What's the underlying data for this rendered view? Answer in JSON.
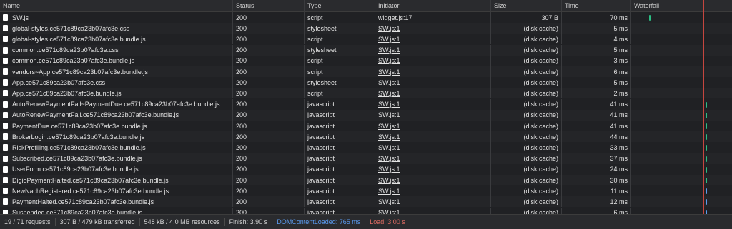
{
  "columns": {
    "name": "Name",
    "status": "Status",
    "type": "Type",
    "initiator": "Initiator",
    "size": "Size",
    "time": "Time",
    "waterfall": "Waterfall"
  },
  "rows": [
    {
      "name": "SW.js",
      "status": "200",
      "type": "script",
      "initiator": "widget.js:17",
      "size": "307 B",
      "time": "70 ms",
      "wf_pos": 0.18,
      "wf_color": "#2bbf83"
    },
    {
      "name": "global-styles.ce571c89ca23b07afc3e.css",
      "status": "200",
      "type": "stylesheet",
      "initiator": "SW.js:1",
      "size": "(disk cache)",
      "time": "5 ms",
      "wf_pos": 0.71,
      "wf_color": "#6b8fbf"
    },
    {
      "name": "global-styles.ce571c89ca23b07afc3e.bundle.js",
      "status": "200",
      "type": "script",
      "initiator": "SW.js:1",
      "size": "(disk cache)",
      "time": "4 ms",
      "wf_pos": 0.71,
      "wf_color": "#6b8fbf"
    },
    {
      "name": "common.ce571c89ca23b07afc3e.css",
      "status": "200",
      "type": "stylesheet",
      "initiator": "SW.js:1",
      "size": "(disk cache)",
      "time": "5 ms",
      "wf_pos": 0.71,
      "wf_color": "#6b8fbf"
    },
    {
      "name": "common.ce571c89ca23b07afc3e.bundle.js",
      "status": "200",
      "type": "script",
      "initiator": "SW.js:1",
      "size": "(disk cache)",
      "time": "3 ms",
      "wf_pos": 0.71,
      "wf_color": "#6b8fbf"
    },
    {
      "name": "vendors~App.ce571c89ca23b07afc3e.bundle.js",
      "status": "200",
      "type": "script",
      "initiator": "SW.js:1",
      "size": "(disk cache)",
      "time": "6 ms",
      "wf_pos": 0.71,
      "wf_color": "#6b8fbf"
    },
    {
      "name": "App.ce571c89ca23b07afc3e.css",
      "status": "200",
      "type": "stylesheet",
      "initiator": "SW.js:1",
      "size": "(disk cache)",
      "time": "5 ms",
      "wf_pos": 0.71,
      "wf_color": "#6b8fbf"
    },
    {
      "name": "App.ce571c89ca23b07afc3e.bundle.js",
      "status": "200",
      "type": "script",
      "initiator": "SW.js:1",
      "size": "(disk cache)",
      "time": "2 ms",
      "wf_pos": 0.71,
      "wf_color": "#6b8fbf"
    },
    {
      "name": "AutoRenewPaymentFail~PaymentDue.ce571c89ca23b07afc3e.bundle.js",
      "status": "200",
      "type": "javascript",
      "initiator": "SW.js:1",
      "size": "(disk cache)",
      "time": "41 ms",
      "wf_pos": 0.74,
      "wf_color": "#2bbf83"
    },
    {
      "name": "AutoRenewPaymentFail.ce571c89ca23b07afc3e.bundle.js",
      "status": "200",
      "type": "javascript",
      "initiator": "SW.js:1",
      "size": "(disk cache)",
      "time": "41 ms",
      "wf_pos": 0.74,
      "wf_color": "#2bbf83"
    },
    {
      "name": "PaymentDue.ce571c89ca23b07afc3e.bundle.js",
      "status": "200",
      "type": "javascript",
      "initiator": "SW.js:1",
      "size": "(disk cache)",
      "time": "41 ms",
      "wf_pos": 0.74,
      "wf_color": "#2bbf83"
    },
    {
      "name": "BrokerLogin.ce571c89ca23b07afc3e.bundle.js",
      "status": "200",
      "type": "javascript",
      "initiator": "SW.js:1",
      "size": "(disk cache)",
      "time": "44 ms",
      "wf_pos": 0.74,
      "wf_color": "#2bbf83"
    },
    {
      "name": "RiskProfiling.ce571c89ca23b07afc3e.bundle.js",
      "status": "200",
      "type": "javascript",
      "initiator": "SW.js:1",
      "size": "(disk cache)",
      "time": "33 ms",
      "wf_pos": 0.74,
      "wf_color": "#2bbf83"
    },
    {
      "name": "Subscribed.ce571c89ca23b07afc3e.bundle.js",
      "status": "200",
      "type": "javascript",
      "initiator": "SW.js:1",
      "size": "(disk cache)",
      "time": "37 ms",
      "wf_pos": 0.74,
      "wf_color": "#2bbf83"
    },
    {
      "name": "UserForm.ce571c89ca23b07afc3e.bundle.js",
      "status": "200",
      "type": "javascript",
      "initiator": "SW.js:1",
      "size": "(disk cache)",
      "time": "24 ms",
      "wf_pos": 0.74,
      "wf_color": "#2bbf83"
    },
    {
      "name": "DigioPaymentHalted.ce571c89ca23b07afc3e.bundle.js",
      "status": "200",
      "type": "javascript",
      "initiator": "SW.js:1",
      "size": "(disk cache)",
      "time": "30 ms",
      "wf_pos": 0.74,
      "wf_color": "#2bbf83"
    },
    {
      "name": "NewNachRegistered.ce571c89ca23b07afc3e.bundle.js",
      "status": "200",
      "type": "javascript",
      "initiator": "SW.js:1",
      "size": "(disk cache)",
      "time": "11 ms",
      "wf_pos": 0.74,
      "wf_color": "#5b9bf0"
    },
    {
      "name": "PaymentHalted.ce571c89ca23b07afc3e.bundle.js",
      "status": "200",
      "type": "javascript",
      "initiator": "SW.js:1",
      "size": "(disk cache)",
      "time": "12 ms",
      "wf_pos": 0.74,
      "wf_color": "#5b9bf0"
    },
    {
      "name": "Suspended.ce571c89ca23b07afc3e.bundle.js",
      "status": "200",
      "type": "javascript",
      "initiator": "SW.js:1",
      "size": "(disk cache)",
      "time": "6 ms",
      "wf_pos": 0.74,
      "wf_color": "#5b9bf0"
    }
  ],
  "footer": {
    "requests": "19 / 71 requests",
    "transferred": "307 B / 479 kB transferred",
    "resources": "548 kB / 4.0 MB resources",
    "finish": "Finish: 3.90 s",
    "domcontentloaded": "DOMContentLoaded: 765 ms",
    "load": "Load: 3.00 s"
  },
  "colors": {
    "domcontentloaded_line": "#3b7bd6",
    "load_line": "#c5463f"
  }
}
